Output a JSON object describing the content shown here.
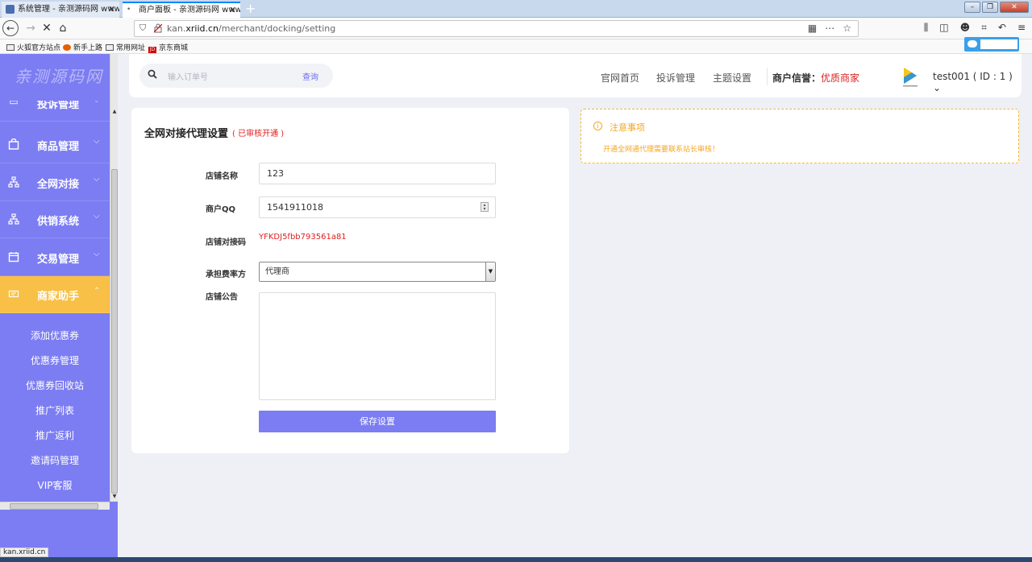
{
  "browser": {
    "tabs": [
      {
        "title": "系统管理 - 亲测源码网 www.q",
        "active": false
      },
      {
        "title": "商户面板 - 亲测源码网 www.q",
        "active": true
      }
    ],
    "url_prefix": "kan.",
    "url_domain": "xriid.cn",
    "url_path": "/merchant/docking/setting",
    "bookmarks": [
      "火狐官方站点",
      "新手上路",
      "常用网址",
      "京东商城"
    ],
    "status_url": "kan.xriid.cn"
  },
  "sidebar": {
    "logo": "亲测源码网",
    "partial_item": "投诉管理",
    "items": [
      {
        "label": "商品管理",
        "icon": "bag-icon"
      },
      {
        "label": "全网对接",
        "icon": "network-icon"
      },
      {
        "label": "供销系统",
        "icon": "network-icon"
      },
      {
        "label": "交易管理",
        "icon": "calendar-icon"
      },
      {
        "label": "商家助手",
        "icon": "ticket-icon"
      }
    ],
    "submenu": [
      "添加优惠券",
      "优惠券管理",
      "优惠券回收站",
      "推广列表",
      "推广返利",
      "邀请码管理",
      "VIP客服"
    ]
  },
  "header": {
    "search_placeholder": "输入订单号",
    "search_button": "查询",
    "nav": [
      "官网首页",
      "投诉管理",
      "主题设置"
    ],
    "credit_label": "商户信誉：",
    "credit_value": "优质商家",
    "user": "test001 ( ID : 1 )"
  },
  "form": {
    "title": "全网对接代理设置",
    "status": "( 已审核开通 )",
    "shop_name_label": "店铺名称",
    "shop_name_value": "123",
    "qq_label": "商户QQ",
    "qq_value": "1541911018",
    "code_label": "店铺对接码",
    "code_value": "YFKDJ5fbb793561a81",
    "fee_label": "承担费率方",
    "fee_value": "代理商",
    "notice_label": "店铺公告",
    "notice_value": "",
    "save_button": "保存设置"
  },
  "notice": {
    "title": "注意事项",
    "text": "开通全网通代理需要联系站长审核！"
  },
  "colors": {
    "accent": "#7c7df2",
    "active": "#f8c047",
    "danger": "#e02020",
    "warning": "#f5a623"
  }
}
